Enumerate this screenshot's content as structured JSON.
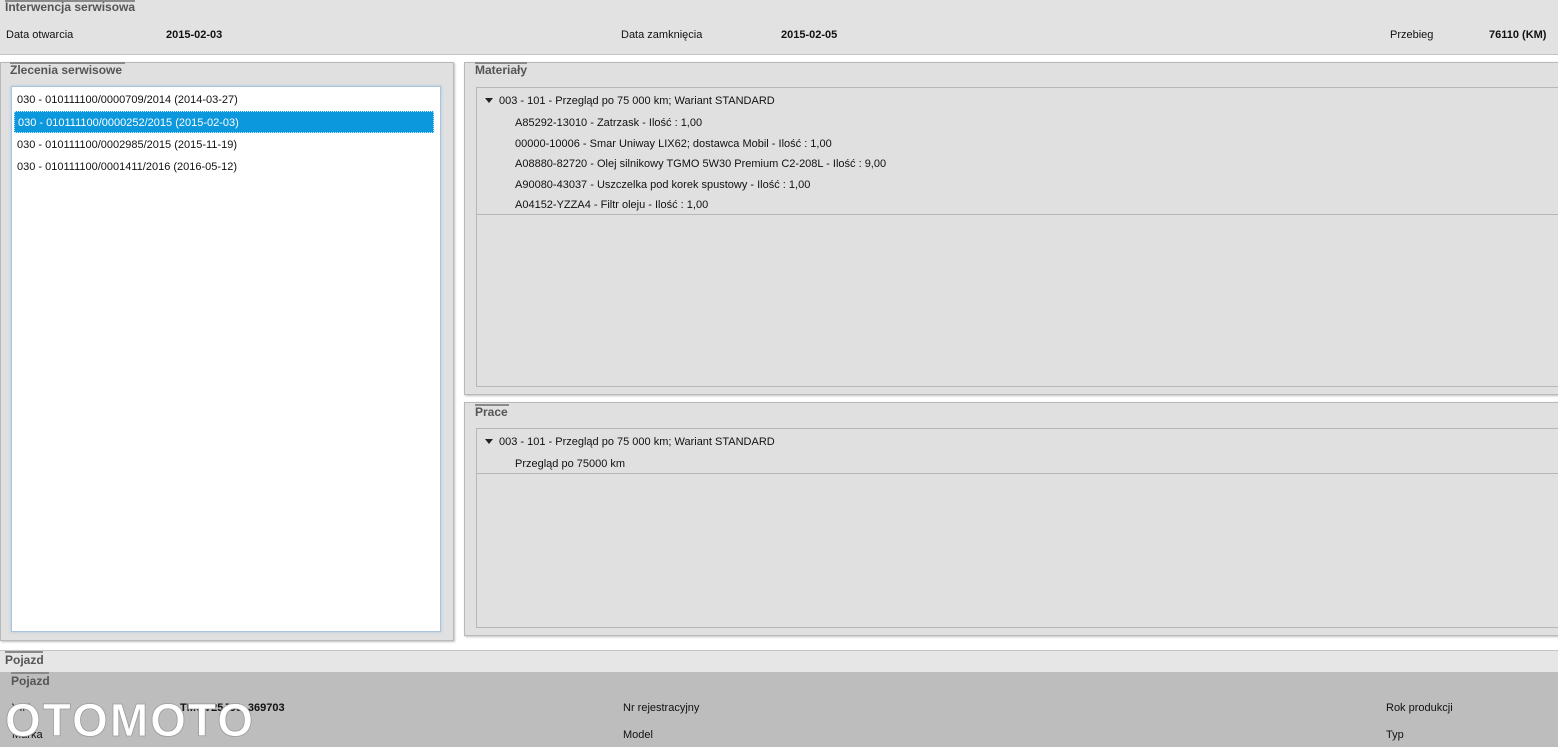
{
  "intervention": {
    "title": "Interwencja serwisowa",
    "open_label": "Data otwarcia",
    "open_value": "2015-02-03",
    "close_label": "Data zamknięcia",
    "close_value": "2015-02-05",
    "mileage_label": "Przebieg",
    "mileage_value": "76110 (KM)"
  },
  "orders": {
    "title": "Zlecenia serwisowe",
    "items": [
      "030 - 010111100/0000709/2014 (2014-03-27)",
      "030 - 010111100/0000252/2015 (2015-02-03)",
      "030 - 010111100/0002985/2015 (2015-11-19)",
      "030 - 010111100/0001411/2016 (2016-05-12)"
    ],
    "selected_index": 1
  },
  "materials": {
    "title": "Materiały",
    "group": "003 - 101 - Przegląd po 75 000 km; Wariant STANDARD",
    "rows": [
      "A85292-13010 - Zatrzask - Ilość : 1,00",
      "00000-10006 - Smar Uniway LIX62; dostawca Mobil - Ilość : 1,00",
      "A08880-82720 - Olej silnikowy TGMO 5W30 Premium C2-208L - Ilość : 9,00",
      "A90080-43037 - Uszczelka pod korek spustowy - Ilość : 1,00",
      "A04152-YZZA4 - Filtr oleju - Ilość : 1,00"
    ]
  },
  "works": {
    "title": "Prace",
    "group": "003 - 101 - Przegląd po 75 000 km; Wariant STANDARD",
    "rows": [
      "Przegląd po 75000 km"
    ]
  },
  "vehicle": {
    "section_title": "Pojazd",
    "inner_title": "Pojazd",
    "vin_label": "VIN",
    "vin_value": "TMUV25J50_369703",
    "reg_label": "Nr rejestracyjny",
    "year_label": "Rok produkcji",
    "make_label": "Marka",
    "model_label": "Model",
    "type_label": "Typ"
  },
  "watermark": {
    "text": "OTOMOTO"
  },
  "colors": {
    "selected_bg": "#0c98dc",
    "panel_bg": "#e0e0e0",
    "vehicle_bg": "#bdbdbd"
  }
}
